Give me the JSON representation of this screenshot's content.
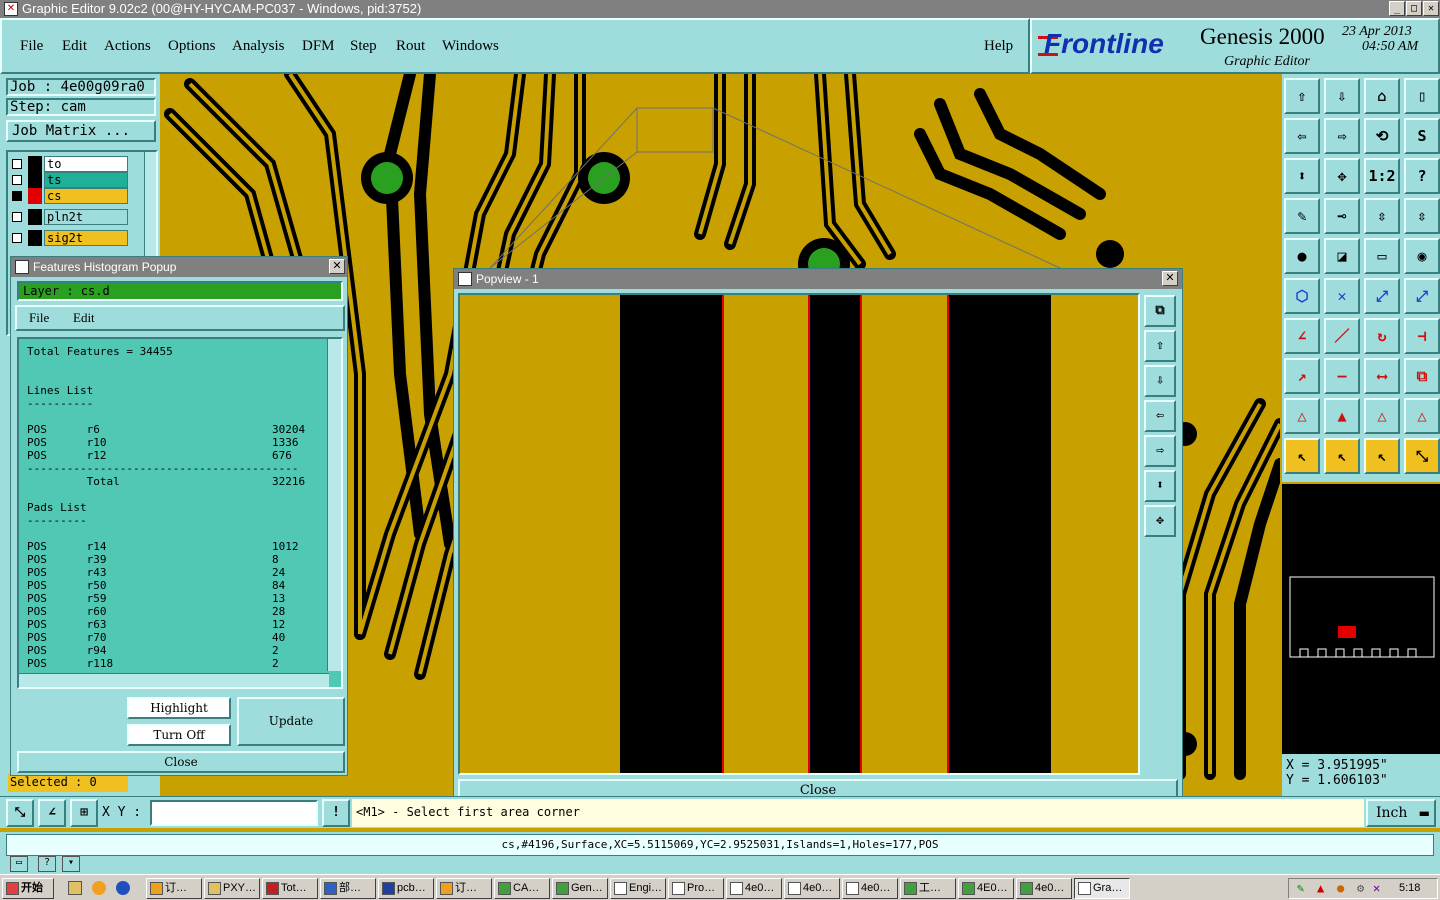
{
  "titlebar": {
    "title": "Graphic Editor 9.02c2 (00@HY-HYCAM-PC037 - Windows, pid:3752)"
  },
  "menu": {
    "items": [
      "File",
      "Edit",
      "Actions",
      "Options",
      "Analysis",
      "DFM",
      "Step",
      "Rout",
      "Windows"
    ],
    "help": "Help"
  },
  "brand": {
    "logo": "Frontline",
    "product": "Genesis 2000",
    "subtitle": "Graphic Editor",
    "date": "23 Apr 2013",
    "time": "04:50 AM"
  },
  "left": {
    "job": "Job : 4e00g09ra0",
    "step": "Step: cam",
    "matrix": "Job Matrix ...",
    "layers": [
      {
        "name": "to",
        "color": "#ffffff",
        "swatch": "#000000"
      },
      {
        "name": "ts",
        "color": "#20b098",
        "swatch": "#000000"
      },
      {
        "name": "cs",
        "color": "#f0c020",
        "swatch": "#e00000"
      },
      {
        "name": "pln2t",
        "color": "#9fdcdc",
        "swatch": "#000000"
      },
      {
        "name": "sig2t",
        "color": "#f0c020",
        "swatch": "#000000"
      }
    ],
    "selected": "Selected : 0"
  },
  "histogram": {
    "title": "Features Histogram Popup",
    "layer": "Layer :  cs.d",
    "menu_file": "File",
    "menu_edit": "Edit",
    "lines": [
      "Total Features = 34455",
      "",
      "",
      "Lines List",
      "----------",
      "",
      "POS      r6                          30204",
      "POS      r10                         1336",
      "POS      r12                         676",
      "-----------------------------------------",
      "         Total                       32216",
      "",
      "Pads List",
      "---------",
      "",
      "POS      r14                         1012",
      "POS      r39                         8",
      "POS      r43                         24",
      "POS      r50                         84",
      "POS      r59                         13",
      "POS      r60                         28",
      "POS      r63                         12",
      "POS      r70                         40",
      "POS      r94                         2",
      "POS      r118                        2"
    ],
    "highlight": "Highlight",
    "turnoff": "Turn Off",
    "update": "Update",
    "close": "Close"
  },
  "popview": {
    "title": "Popview - 1",
    "close": "Close"
  },
  "coords": {
    "x": "X = 3.951995\"",
    "y": "Y = 1.606103\""
  },
  "prompt": {
    "xy_label": "X Y :",
    "message": "<M1> - Select first area corner",
    "units": "Inch"
  },
  "status": {
    "text": "cs,#4196,Surface,XC=5.5115069,YC=2.9525031,Islands=1,Holes=177,POS"
  },
  "taskbar": {
    "start": "开始",
    "items": [
      "订…",
      "PXY…",
      "Tot…",
      "部…",
      "pcb…",
      "订…",
      "CA…",
      "Gen…",
      "Engi…",
      "Pro…",
      "4e0…",
      "4e0…",
      "4e0…",
      "工…",
      "4E0…",
      "4e0…",
      "Gra…"
    ],
    "clock": "5:18"
  },
  "toolbar": {
    "buttons": [
      "⇧",
      "⇩",
      "⌂",
      "▯",
      "⇦",
      "⇨",
      "⟲",
      "S",
      "⬍",
      "✥",
      "1:2",
      "?",
      "✎",
      "⊸",
      "⇳",
      "⇳",
      "●",
      "◪",
      "▭",
      "◉",
      "⬡",
      "✕",
      "⤢",
      "⤢",
      "∠",
      "／",
      "↻",
      "⊣",
      "↗",
      "—",
      "⟷",
      "⧉",
      "△",
      "▲",
      "△",
      "△",
      "↖",
      "↖",
      "↖",
      "⤡"
    ]
  }
}
